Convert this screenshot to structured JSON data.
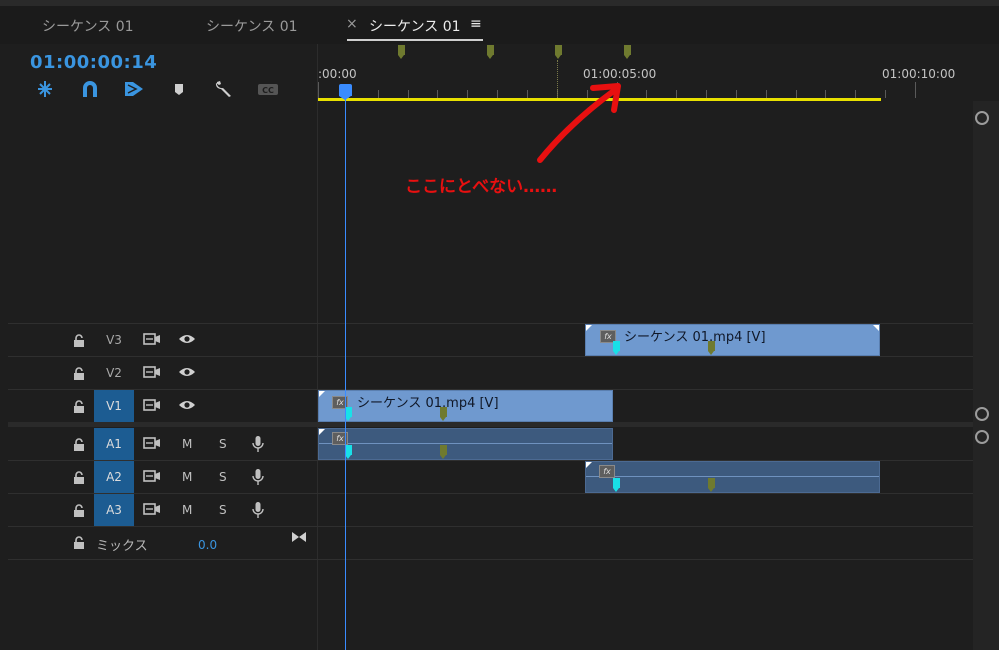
{
  "tabs": [
    {
      "label": "シーケンス 01",
      "active": false
    },
    {
      "label": "シーケンス 01",
      "active": false
    },
    {
      "label": "シーケンス 01",
      "active": true,
      "close": "×",
      "menu": "≡"
    }
  ],
  "timecode": "01:00:00:14",
  "tools": [
    "snap-in-sequence-icon",
    "linked-selection-icon",
    "marker-select-icon",
    "add-marker-icon",
    "settings-wrench-icon",
    "captions-icon"
  ],
  "ruler": {
    "labels": [
      ":00:00",
      "01:00:05:00",
      "01:00:10:00"
    ]
  },
  "annotation": "ここにとべない……",
  "video_tracks": [
    {
      "name": "V3",
      "selected": false
    },
    {
      "name": "V2",
      "selected": false
    },
    {
      "name": "V1",
      "selected": true
    }
  ],
  "audio_tracks": [
    {
      "name": "A1",
      "selected": true,
      "m": "M",
      "s": "S"
    },
    {
      "name": "A2",
      "selected": true,
      "m": "M",
      "s": "S"
    },
    {
      "name": "A3",
      "selected": true,
      "m": "M",
      "s": "S"
    }
  ],
  "mix": {
    "label": "ミックス",
    "value": "0.0"
  },
  "clips": {
    "v3": "シーケンス 01.mp4 [V]",
    "v1": "シーケンス 01.mp4 [V]",
    "fx": "fx"
  },
  "colors": {
    "accent": "#3a95e0",
    "work_area": "#e8e000",
    "annotation": "#e81010",
    "clip_video": "#6f99cf",
    "clip_audio": "#3d5a7e"
  }
}
